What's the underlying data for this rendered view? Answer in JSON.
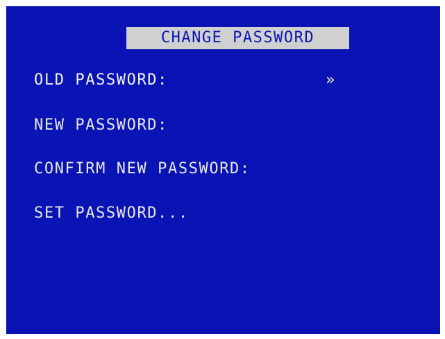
{
  "screen": {
    "background_color": "#0a14b4",
    "text_color": "#e6e6e6",
    "title_bar_color": "#d0d0d0",
    "title": "CHANGE PASSWORD"
  },
  "menu": {
    "items": [
      {
        "label": "OLD PASSWORD:",
        "selected": true
      },
      {
        "label": "NEW PASSWORD:",
        "selected": false
      },
      {
        "label": "CONFIRM NEW PASSWORD:",
        "selected": false
      },
      {
        "label": "SET PASSWORD...",
        "selected": false
      }
    ],
    "cursor_glyph": "»"
  }
}
